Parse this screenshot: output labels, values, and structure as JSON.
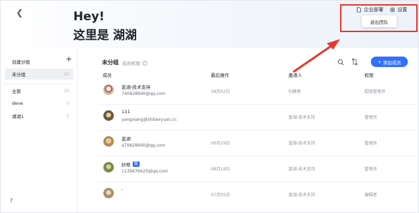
{
  "header": {
    "back_icon": "chevron-left-icon",
    "greeting": "Hey!",
    "subtitle": "这里是 湖湖",
    "deploy_label": "企业部署",
    "settings_label": "设置",
    "popup_item": "退出团队"
  },
  "sidebar": {
    "title": "创建分组",
    "add_icon": "plus-icon",
    "items": [
      {
        "label": "未分组",
        "count": "10"
      },
      {
        "label": "全部",
        "count": "10"
      },
      {
        "label": "deve",
        "count": "0"
      },
      {
        "label": "湖湖1",
        "count": "0"
      }
    ],
    "help_label": "?"
  },
  "main": {
    "title": "未分组",
    "subtitle": "成员权限",
    "add_button": "添加成员",
    "columns": [
      "成员",
      "最后操作",
      "邀请人",
      "权限"
    ],
    "rows": [
      {
        "name": "蓝湖-技术支持",
        "email": "740828940@qq.com",
        "badge": "",
        "last_op": "08月02日",
        "inviter": "创建者",
        "permission": "超级管理员",
        "avatar_color": "#c8b8a8"
      },
      {
        "name": "111",
        "email": "yangxiang@shiberyuan.cc",
        "badge": "",
        "last_op": "",
        "inviter": "蓝湖-技术支持",
        "permission": "管理员",
        "avatar_color": "#6b5a3e"
      },
      {
        "name": "蓝湖",
        "email": "a70828940@qq.com",
        "badge": "",
        "last_op": "06月29日",
        "inviter": "蓝湖-技术支持",
        "permission": "管理员",
        "avatar_color": "#b08a5a"
      },
      {
        "name": "狄根",
        "email": "1139476625@qq.com",
        "badge": "我",
        "last_op": "08月18日",
        "inviter": "蓝湖-技术支持",
        "permission": "管理员",
        "avatar_color": "#7a8a4a"
      },
      {
        "name": "-",
        "email": "",
        "badge": "",
        "last_op": "07月05日",
        "inviter": "蓝湖-技术支持",
        "permission": "编辑者",
        "avatar_color": "#a8926a"
      }
    ]
  },
  "colors": {
    "accent": "#3370ff",
    "annotation": "#e5382b"
  }
}
